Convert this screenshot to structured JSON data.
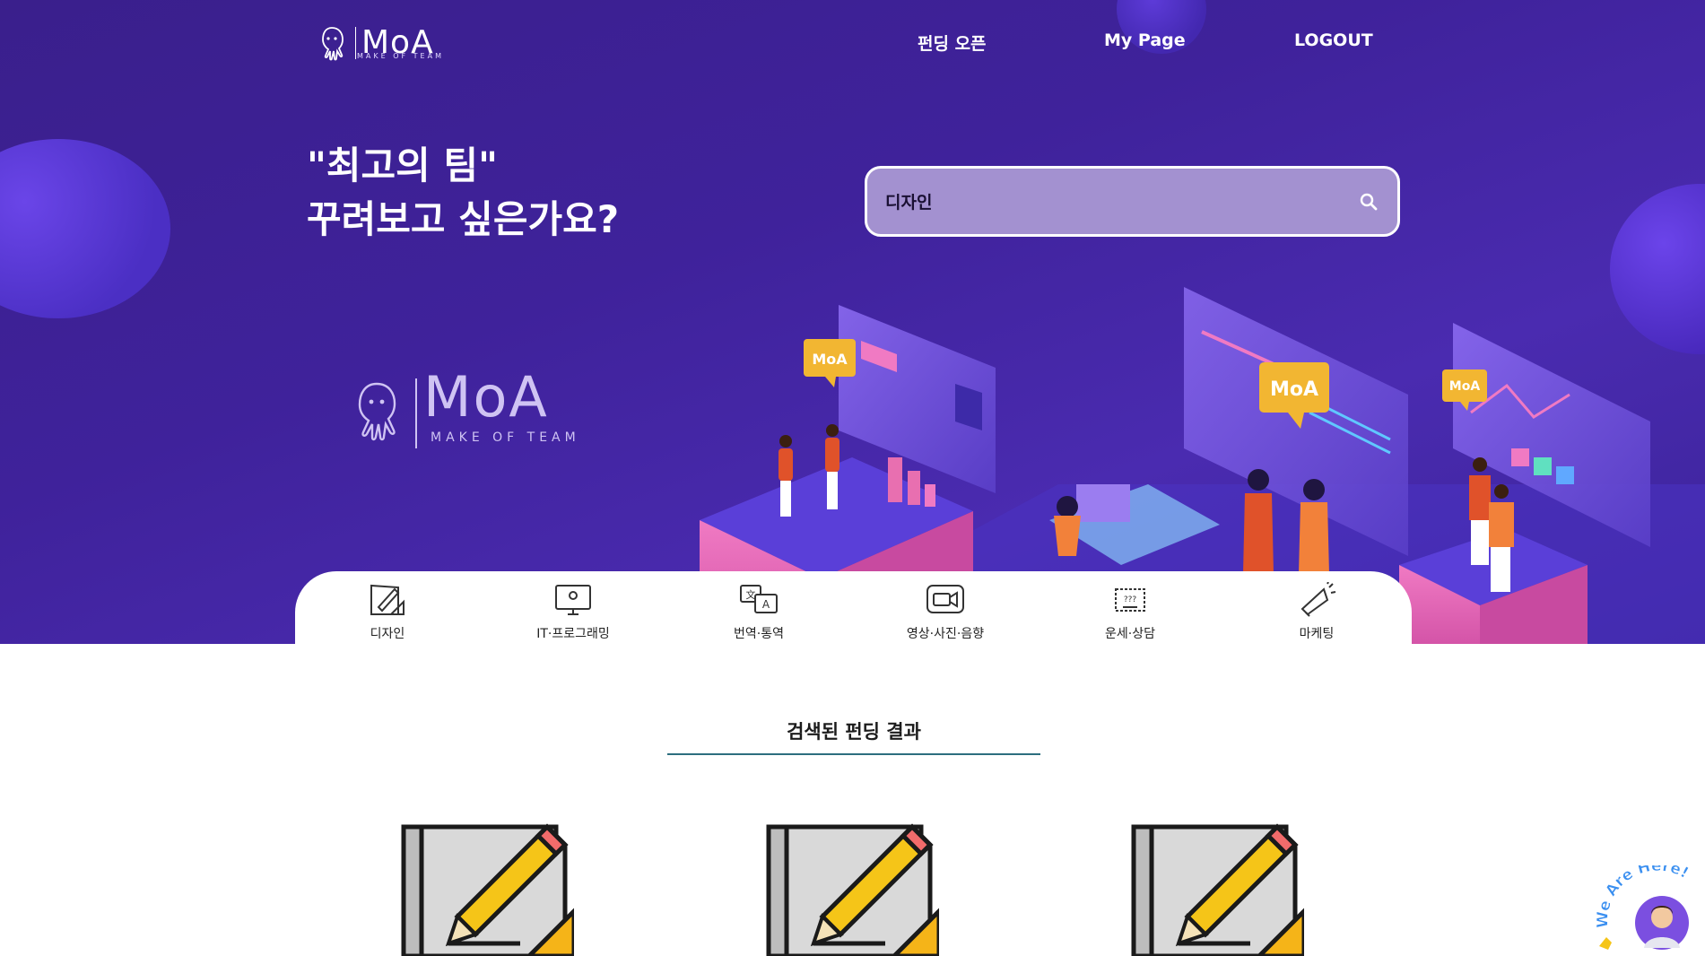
{
  "header": {
    "logo_text": "MoA",
    "logo_sub": "MAKE OF TEAM",
    "nav": [
      {
        "label": "펀딩 오픈"
      },
      {
        "label": "My Page"
      },
      {
        "label": "LOGOUT"
      }
    ]
  },
  "hero": {
    "headline_line1": "\"최고의 팀\"",
    "headline_line2": "꾸려보고 싶은가요?",
    "big_logo_text": "MoA",
    "big_logo_sub": "MAKE OF TEAM",
    "illustration_badges": [
      "MoA",
      "MoA",
      "MoA"
    ]
  },
  "search": {
    "value": "디자인",
    "icon": "search-icon"
  },
  "categories": [
    {
      "label": "디자인",
      "icon": "design-icon"
    },
    {
      "label": "IT·프로그래밍",
      "icon": "monitor-icon"
    },
    {
      "label": "번역·통역",
      "icon": "translate-icon"
    },
    {
      "label": "영상·사진·음향",
      "icon": "video-camera-icon"
    },
    {
      "label": "운세·상담",
      "icon": "fortune-icon"
    },
    {
      "label": "마케팅",
      "icon": "megaphone-icon"
    }
  ],
  "results": {
    "title": "검색된 펀딩 결과",
    "cards": [
      {
        "icon": "design-pencil-icon"
      },
      {
        "icon": "design-pencil-icon"
      },
      {
        "icon": "design-pencil-icon"
      }
    ]
  },
  "chat_widget": {
    "text": "We Are Here!",
    "icon": "support-avatar-icon"
  },
  "colors": {
    "hero_bg": "#3f229b",
    "search_bg": "#a391d0",
    "underline": "#2d6e7e",
    "accent_yellow": "#f2b632",
    "accent_pink": "#e86fb0"
  }
}
